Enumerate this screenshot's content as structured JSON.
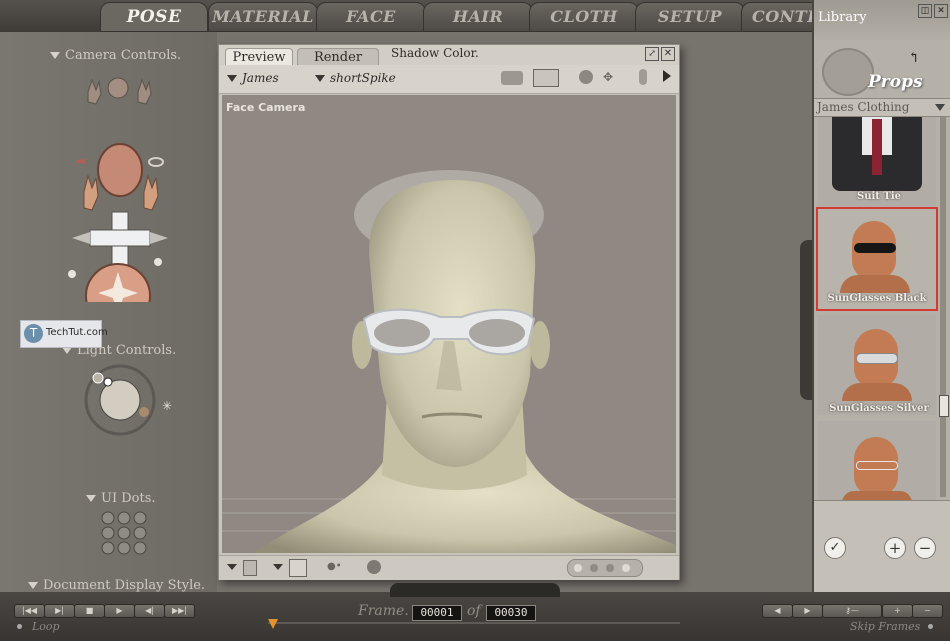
{
  "tabs": [
    "POSE",
    "MATERIAL",
    "FACE",
    "HAIR",
    "CLOTH",
    "SETUP",
    "CONTE"
  ],
  "left_panel": {
    "camera_controls": "Camera Controls.",
    "light_controls": "Light Controls.",
    "ui_dots": "UI Dots.",
    "document_display_style": "Document Display Style."
  },
  "watermark": "TechTut.com",
  "document_window": {
    "tab_preview": "Preview",
    "tab_render": "Render",
    "shadow_color": "Shadow Color.",
    "figure_menu": "James",
    "element_menu": "shortSpike",
    "camera_label": "Face Camera"
  },
  "library": {
    "title": "Library",
    "category": "Props",
    "subcategory": "James Clothing",
    "items": [
      {
        "label": "Suit Tie"
      },
      {
        "label": "SunGlasses Black"
      },
      {
        "label": "SunGlasses Silver"
      },
      {
        "label": ""
      }
    ]
  },
  "timeline": {
    "frame_label": "Frame.",
    "current_frame": "00001",
    "of_label": "of",
    "total_frames": "00030",
    "loop_label": "Loop",
    "skip_frames_label": "Skip Frames"
  },
  "colors": {
    "selected_item_border": "#d23a33",
    "tab_active_text": "#f3f1ea"
  }
}
